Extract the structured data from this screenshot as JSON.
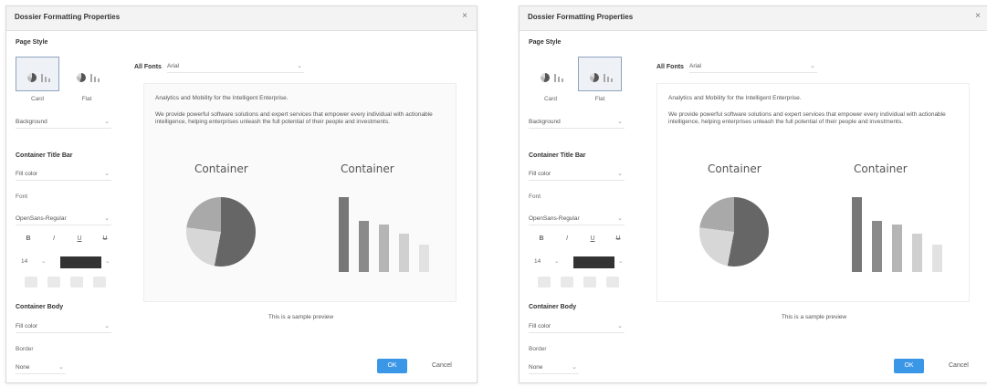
{
  "dialog": {
    "title": "Dossier Formatting Properties",
    "close_glyph": "×"
  },
  "page_style": {
    "heading": "Page Style",
    "card_label": "Card",
    "flat_label": "Flat",
    "background_label": "Background"
  },
  "all_fonts": {
    "label": "All Fonts",
    "value": "Arial"
  },
  "container_title_bar": {
    "heading": "Container Title Bar",
    "fill_color_label": "Fill color",
    "font_label": "Font",
    "font_value_left": "OpenSans-Regular",
    "font_value_right": "OpenSans-Regular",
    "bold": "B",
    "italic": "I",
    "underline": "U",
    "strike": "U",
    "size": "14"
  },
  "container_body": {
    "heading": "Container Body",
    "fill_color_label": "Fill color",
    "border_label": "Border",
    "border_value": "None"
  },
  "preview": {
    "headline": "Analytics and Mobility for the Intelligent Enterprise.",
    "body": "We provide powerful software solutions and expert services that empower every individual with actionable intelligence, helping enterprises unleash the full potential of their people and investments.",
    "container_1": "Container",
    "container_2": "Container",
    "sample_caption": "This is a sample preview"
  },
  "buttons": {
    "ok": "OK",
    "cancel": "Cancel"
  },
  "colors": {
    "accent": "#3a96e6",
    "swatch": "#333333"
  },
  "icons": {
    "chevron": "chevron-down-icon",
    "close": "close-icon",
    "align_left": "align-left-icon",
    "align_center": "align-center-icon",
    "align_right": "align-right-icon",
    "align_justify": "align-justify-icon"
  }
}
